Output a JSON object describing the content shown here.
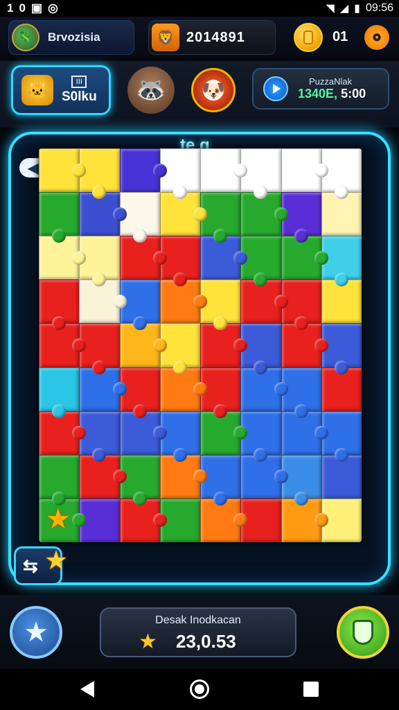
{
  "status_bar": {
    "left_glyphs": [
      "1",
      "0"
    ],
    "time": "09:56"
  },
  "header": {
    "profile_name": "Brvozisia",
    "score": "2014891",
    "coin_count": "01"
  },
  "row2": {
    "level_label": "S0lku",
    "level_mark": "III",
    "puzzle_title": "PuzzaNlak",
    "puzzle_stats_a": "1340E,",
    "puzzle_stats_b": "5:00"
  },
  "board": {
    "title": "te g",
    "rows": 9,
    "cols": 8,
    "grid": [
      [
        "#ffe23a",
        "#ffe23a",
        "#4633d6",
        "#ffffff",
        "#ffffff",
        "#ffffff",
        "#ffffff",
        "#ffffff"
      ],
      [
        "#27a92e",
        "#3b4fd0",
        "#fbf7ea",
        "#ffe23a",
        "#27a92e",
        "#27a92e",
        "#5a2ed6",
        "#fff4b2"
      ],
      [
        "#fff39a",
        "#fff39a",
        "#e8201e",
        "#e8201e",
        "#3b5bd8",
        "#27a92e",
        "#27a92e",
        "#3fcfe8"
      ],
      [
        "#e8201e",
        "#fbf3d8",
        "#2f6fe8",
        "#ff7a12",
        "#ffe23a",
        "#e8201e",
        "#e8201e",
        "#ffe23a"
      ],
      [
        "#e8201e",
        "#e8201e",
        "#ffb61a",
        "#ffe23a",
        "#e8201e",
        "#3b5bd8",
        "#e8201e",
        "#3b5bd8"
      ],
      [
        "#2bc6e6",
        "#2f6fe8",
        "#e8201e",
        "#ff7a12",
        "#e8201e",
        "#2f6fe8",
        "#2f6fe8",
        "#e8201e"
      ],
      [
        "#e8201e",
        "#3b5bd8",
        "#3b5bd8",
        "#2f6fe8",
        "#27a92e",
        "#2f6fe8",
        "#2f6fe8",
        "#2f6fe8"
      ],
      [
        "#27a92e",
        "#e8201e",
        "#27a92e",
        "#ff7a12",
        "#2f6fe8",
        "#2f6fe8",
        "#3b8ee8",
        "#3b5bd8"
      ],
      [
        "#27a92e",
        "#5a2ed6",
        "#e8201e",
        "#27a92e",
        "#ff7a12",
        "#e8201e",
        "#ff9a12",
        "#fff07a"
      ]
    ]
  },
  "bottom": {
    "hint_title": "Desak Inodkacan",
    "hint_value": "23,0.53"
  },
  "colors": {
    "accent": "#36e0ff",
    "coin": "#f0a400",
    "stat_green": "#5cf0a0"
  },
  "icons": [
    "wifi-icon",
    "signal-icon",
    "battery-icon",
    "settings-gear-icon",
    "play-icon",
    "star-icon",
    "shield-icon",
    "back-arrow-icon"
  ]
}
